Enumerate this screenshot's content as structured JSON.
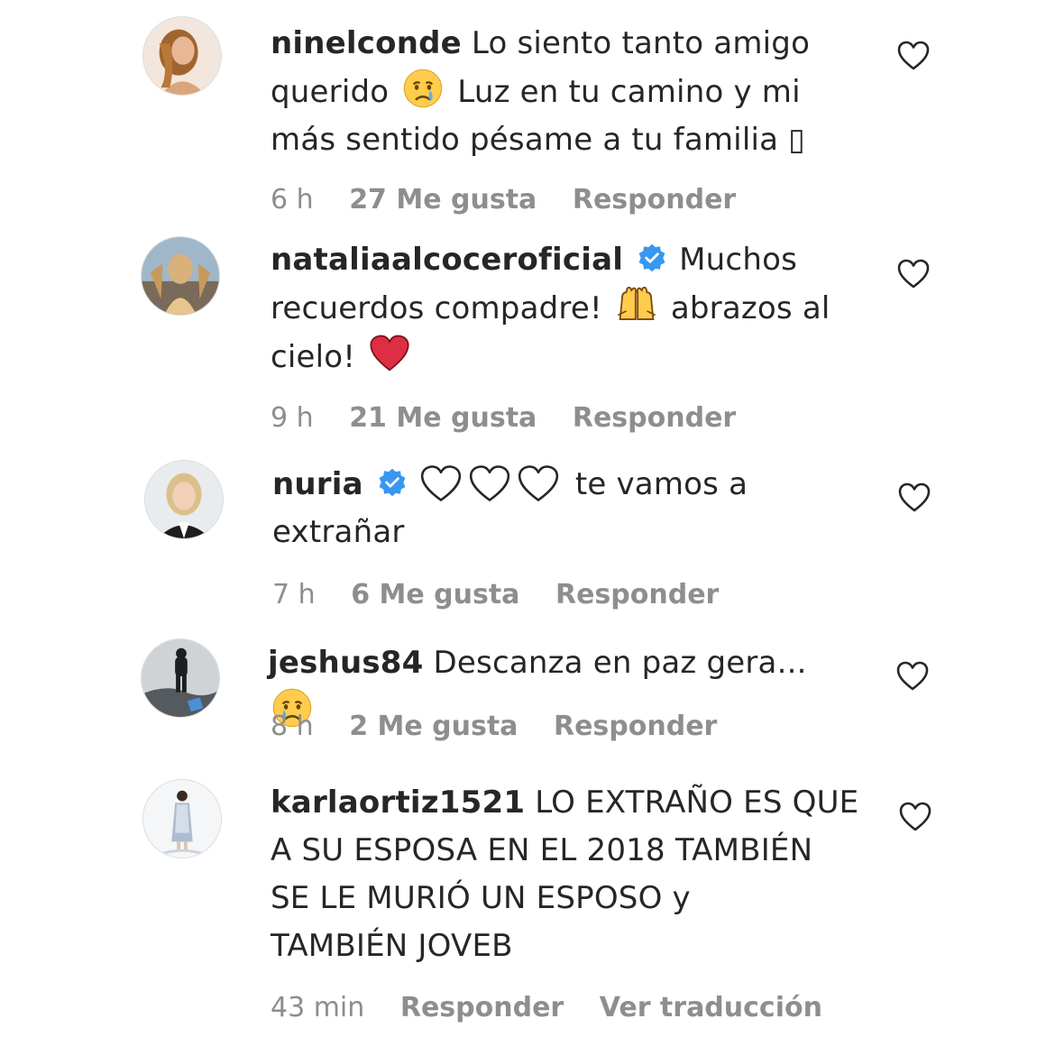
{
  "comments": [
    {
      "username": "ninelconde",
      "verified": false,
      "text_1": "Lo siento tanto amigo",
      "text_2": "querido",
      "text_3": "Luz en tu camino y mi",
      "text_4": "más sentido pésame a tu familia",
      "text_5": "▯",
      "time": "6 h",
      "likes": "27 Me gusta",
      "reply": "Responder"
    },
    {
      "username": "nataliaalcoceroficial",
      "verified": true,
      "text_1": "Muchos",
      "text_2": "recuerdos compadre!",
      "text_3": "abrazos al",
      "text_4": "cielo!",
      "time": "9 h",
      "likes": "21 Me gusta",
      "reply": "Responder"
    },
    {
      "username": "nuria",
      "verified": true,
      "text_1": "te vamos a",
      "text_2": "extrañar",
      "time": "7 h",
      "likes": "6 Me gusta",
      "reply": "Responder"
    },
    {
      "username": "jeshus84",
      "verified": false,
      "text_1": "Descanza en paz gera...",
      "time": "8 h",
      "likes": "2 Me gusta",
      "reply": "Responder"
    },
    {
      "username": "karlaortiz1521",
      "verified": false,
      "text_1": "LO EXTRAÑO ES QUE",
      "text_2": "A SU ESPOSA EN EL 2018 TAMBIÉN",
      "text_3": "SE LE MURIÓ UN ESPOSO y",
      "text_4": "TAMBIÉN JOVEB",
      "time": "43 min",
      "reply": "Responder",
      "translate": "Ver traducción"
    }
  ],
  "colors": {
    "text": "#262626",
    "meta": "#8e8e8e",
    "verified": "#3897f0"
  },
  "icons": {
    "like": "heart-outline-icon",
    "verified": "verified-badge-icon",
    "emoji_crying": "crying-face-emoji",
    "emoji_raised_hands": "raising-hands-emoji",
    "emoji_red_heart": "red-heart-emoji",
    "emoji_white_heart": "white-heart-emoji"
  }
}
